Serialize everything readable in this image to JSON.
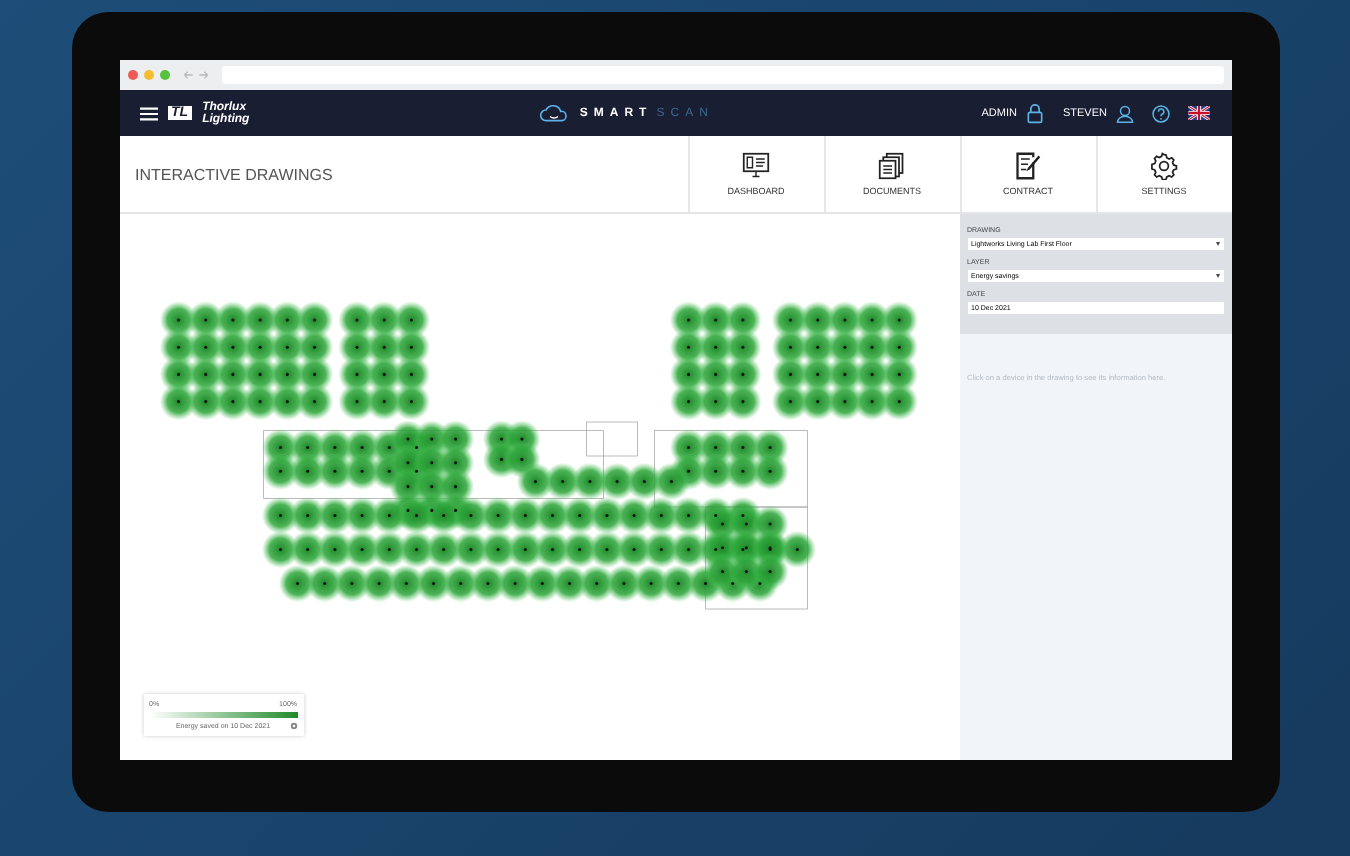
{
  "app": {
    "logo_mark": "TL",
    "logo_text": "Thorlux Lighting",
    "brand_primary": "SMART",
    "brand_secondary": "SCAN"
  },
  "user_menu": {
    "role": "ADMIN",
    "user": "STEVEN"
  },
  "page": {
    "title": "INTERACTIVE DRAWINGS"
  },
  "nav": [
    {
      "label": "DASHBOARD",
      "kind": "dashboard"
    },
    {
      "label": "DOCUMENTS",
      "kind": "documents"
    },
    {
      "label": "CONTRACT",
      "kind": "contract"
    },
    {
      "label": "SETTINGS",
      "kind": "settings"
    }
  ],
  "filters": [
    {
      "label": "DRAWING",
      "kind": "select",
      "value": "Lightworks Living Lab First Floor"
    },
    {
      "label": "LAYER",
      "kind": "select",
      "value": "Energy savings"
    },
    {
      "label": "DATE",
      "kind": "input",
      "value": "10 Dec 2021"
    }
  ],
  "info": "Click on a device in the drawing to see its information here.",
  "legend": {
    "min": "0%",
    "max": "100%",
    "caption": "Energy saved on 10 Dec 2021"
  }
}
